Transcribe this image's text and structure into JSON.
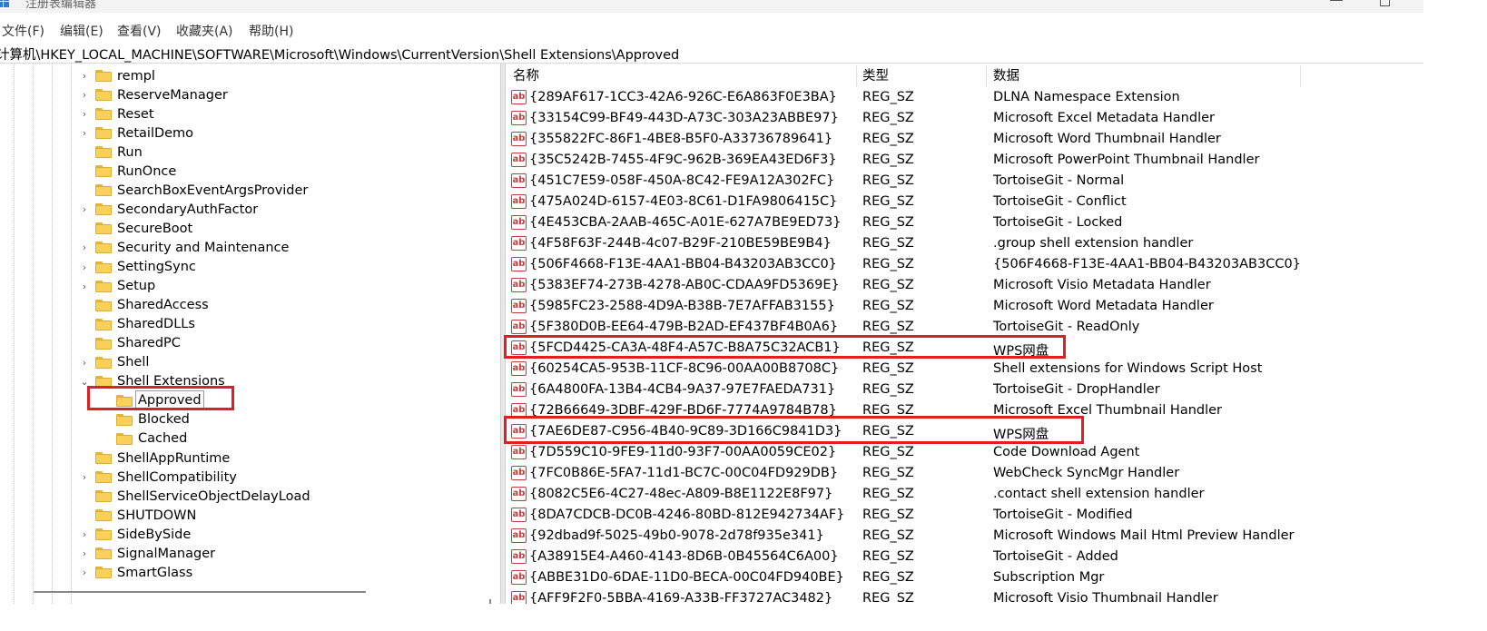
{
  "window": {
    "title": "注册表编辑器"
  },
  "menu": [
    "文件(F)",
    "编辑(E)",
    "查看(V)",
    "收藏夹(A)",
    "帮助(H)"
  ],
  "address": "计算机\\HKEY_LOCAL_MACHINE\\SOFTWARE\\Microsoft\\Windows\\CurrentVersion\\Shell Extensions\\Approved",
  "tree": [
    {
      "label": "rempl",
      "expander": "›"
    },
    {
      "label": "ReserveManager",
      "expander": "›"
    },
    {
      "label": "Reset",
      "expander": "›"
    },
    {
      "label": "RetailDemo",
      "expander": "›"
    },
    {
      "label": "Run",
      "expander": ""
    },
    {
      "label": "RunOnce",
      "expander": ""
    },
    {
      "label": "SearchBoxEventArgsProvider",
      "expander": ""
    },
    {
      "label": "SecondaryAuthFactor",
      "expander": "›"
    },
    {
      "label": "SecureBoot",
      "expander": ""
    },
    {
      "label": "Security and Maintenance",
      "expander": "›"
    },
    {
      "label": "SettingSync",
      "expander": "›"
    },
    {
      "label": "Setup",
      "expander": "›"
    },
    {
      "label": "SharedAccess",
      "expander": ""
    },
    {
      "label": "SharedDLLs",
      "expander": ""
    },
    {
      "label": "SharedPC",
      "expander": ""
    },
    {
      "label": "Shell",
      "expander": "›"
    },
    {
      "label": "Shell Extensions",
      "expander": "⌄"
    },
    {
      "label": "Approved",
      "expander": "",
      "child": true,
      "selected": true
    },
    {
      "label": "Blocked",
      "expander": "",
      "child": true
    },
    {
      "label": "Cached",
      "expander": "",
      "child": true
    },
    {
      "label": "ShellAppRuntime",
      "expander": ""
    },
    {
      "label": "ShellCompatibility",
      "expander": "›"
    },
    {
      "label": "ShellServiceObjectDelayLoad",
      "expander": ""
    },
    {
      "label": "SHUTDOWN",
      "expander": ""
    },
    {
      "label": "SideBySide",
      "expander": "›"
    },
    {
      "label": "SignalManager",
      "expander": "›"
    },
    {
      "label": "SmartGlass",
      "expander": "›"
    }
  ],
  "columns": {
    "name": "名称",
    "type": "类型",
    "data": "数据"
  },
  "rows": [
    {
      "name": "{289AF617-1CC3-42A6-926C-E6A863F0E3BA}",
      "type": "REG_SZ",
      "data": "DLNA Namespace Extension"
    },
    {
      "name": "{33154C99-BF49-443D-A73C-303A23ABBE97}",
      "type": "REG_SZ",
      "data": "Microsoft Excel Metadata Handler"
    },
    {
      "name": "{355822FC-86F1-4BE8-B5F0-A33736789641}",
      "type": "REG_SZ",
      "data": "Microsoft Word Thumbnail Handler"
    },
    {
      "name": "{35C5242B-7455-4F9C-962B-369EA43ED6F3}",
      "type": "REG_SZ",
      "data": "Microsoft PowerPoint Thumbnail Handler"
    },
    {
      "name": "{451C7E59-058F-450A-8C42-FE9A12A302FC}",
      "type": "REG_SZ",
      "data": "TortoiseGit - Normal"
    },
    {
      "name": "{475A024D-6157-4E03-8C61-D1FA9806415C}",
      "type": "REG_SZ",
      "data": "TortoiseGit - Conflict"
    },
    {
      "name": "{4E453CBA-2AAB-465C-A01E-627A7BE9ED73}",
      "type": "REG_SZ",
      "data": "TortoiseGit - Locked"
    },
    {
      "name": "{4F58F63F-244B-4c07-B29F-210BE59BE9B4}",
      "type": "REG_SZ",
      "data": ".group shell extension handler"
    },
    {
      "name": "{506F4668-F13E-4AA1-BB04-B43203AB3CC0}",
      "type": "REG_SZ",
      "data": "{506F4668-F13E-4AA1-BB04-B43203AB3CC0}"
    },
    {
      "name": "{5383EF74-273B-4278-AB0C-CDAA9FD5369E}",
      "type": "REG_SZ",
      "data": "Microsoft Visio Metadata Handler"
    },
    {
      "name": "{5985FC23-2588-4D9A-B38B-7E7AFFAB3155}",
      "type": "REG_SZ",
      "data": "Microsoft Word Metadata Handler"
    },
    {
      "name": "{5F380D0B-EE64-479B-B2AD-EF437BF4B0A6}",
      "type": "REG_SZ",
      "data": "TortoiseGit - ReadOnly"
    },
    {
      "name": "{5FCD4425-CA3A-48F4-A57C-B8A75C32ACB1}",
      "type": "REG_SZ",
      "data": "WPS网盘"
    },
    {
      "name": "{60254CA5-953B-11CF-8C96-00AA00B8708C}",
      "type": "REG_SZ",
      "data": "Shell extensions for Windows Script Host"
    },
    {
      "name": "{6A4800FA-13B4-4CB4-9A37-97E7FAEDA731}",
      "type": "REG_SZ",
      "data": "TortoiseGit - DropHandler"
    },
    {
      "name": "{72B66649-3DBF-429F-BD6F-7774A9784B78}",
      "type": "REG_SZ",
      "data": "Microsoft Excel Thumbnail Handler"
    },
    {
      "name": "{7AE6DE87-C956-4B40-9C89-3D166C9841D3}",
      "type": "REG_SZ",
      "data": "WPS网盘"
    },
    {
      "name": "{7D559C10-9FE9-11d0-93F7-00AA0059CE02}",
      "type": "REG_SZ",
      "data": "Code Download Agent"
    },
    {
      "name": "{7FC0B86E-5FA7-11d1-BC7C-00C04FD929DB}",
      "type": "REG_SZ",
      "data": "WebCheck SyncMgr Handler"
    },
    {
      "name": "{8082C5E6-4C27-48ec-A809-B8E1122E8F97}",
      "type": "REG_SZ",
      "data": ".contact shell extension handler"
    },
    {
      "name": "{8DA7CDCB-DC0B-4246-80BD-812E942734AF}",
      "type": "REG_SZ",
      "data": "TortoiseGit - Modified"
    },
    {
      "name": "{92dbad9f-5025-49b0-9078-2d78f935e341}",
      "type": "REG_SZ",
      "data": "Microsoft Windows Mail Html Preview Handler"
    },
    {
      "name": "{A38915E4-A460-4143-8D6B-0B45564C6A00}",
      "type": "REG_SZ",
      "data": "TortoiseGit - Added"
    },
    {
      "name": "{ABBE31D0-6DAE-11D0-BECA-00C04FD940BE}",
      "type": "REG_SZ",
      "data": "Subscription Mgr"
    },
    {
      "name": "{AFF9F2F0-5BBA-4169-A33B-FF3727AC3482}",
      "type": "REG_SZ",
      "data": "Microsoft Visio Thumbnail Handler"
    }
  ],
  "value_icon": "ab",
  "colors": {
    "highlight": "#e02020",
    "folder": "#f8d05a"
  }
}
